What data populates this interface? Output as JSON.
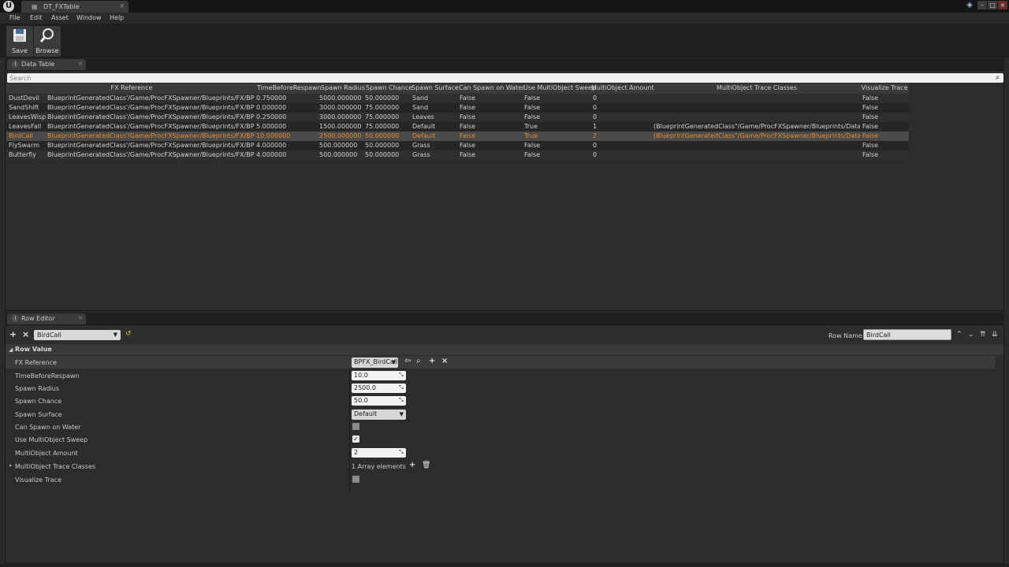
{
  "titlebar": {
    "tab_title": "DT_FXTable"
  },
  "menu": [
    "File",
    "Edit",
    "Asset",
    "Window",
    "Help"
  ],
  "toolbar": {
    "save_label": "Save",
    "browse_label": "Browse"
  },
  "data_table": {
    "tab_label": "Data Table",
    "search_placeholder": "Search",
    "columns": [
      "FX Reference",
      "TimeBeforeRespawn",
      "Spawn Radius",
      "Spawn Chance",
      "Spawn Surface",
      "Can Spawn on Water",
      "Use MultiObject Sweep",
      "MultiObject Amount",
      "MultiObject Trace Classes",
      "Visualize Trace"
    ],
    "rows": [
      {
        "name": "DustDevil",
        "fx": "BlueprintGeneratedClass'/Game/ProcFXSpawner/Blueprints/FX/BPFX_D",
        "time": "0.750000",
        "radius": "5000.000000",
        "chance": "50.000000",
        "surface": "Sand",
        "water": "False",
        "sweep": "False",
        "amount": "0",
        "classes": "",
        "visualize": "False"
      },
      {
        "name": "SandShift",
        "fx": "BlueprintGeneratedClass'/Game/ProcFXSpawner/Blueprints/FX/BPFX_S",
        "time": "0.000000",
        "radius": "3000.000000",
        "chance": "75.000000",
        "surface": "Sand",
        "water": "False",
        "sweep": "False",
        "amount": "0",
        "classes": "",
        "visualize": "False"
      },
      {
        "name": "LeavesWisp",
        "fx": "BlueprintGeneratedClass'/Game/ProcFXSpawner/Blueprints/FX/BPFX_L",
        "time": "0.250000",
        "radius": "3000.000000",
        "chance": "75.000000",
        "surface": "Leaves",
        "water": "False",
        "sweep": "False",
        "amount": "0",
        "classes": "",
        "visualize": "False"
      },
      {
        "name": "LeavesFall",
        "fx": "BlueprintGeneratedClass'/Game/ProcFXSpawner/Blueprints/FX/BPFX_L",
        "time": "5.000000",
        "radius": "1500.000000",
        "chance": "75.000000",
        "surface": "Default",
        "water": "False",
        "sweep": "True",
        "amount": "1",
        "classes": "(BlueprintGeneratedClass\"/Game/ProcFXSpawner/Blueprints/Data/Folia",
        "visualize": "False"
      },
      {
        "name": "BirdCall",
        "fx": "BlueprintGeneratedClass'/Game/ProcFXSpawner/Blueprints/FX/BPFX_B",
        "time": "10.000000",
        "radius": "2500.000000",
        "chance": "50.000000",
        "surface": "Default",
        "water": "False",
        "sweep": "True",
        "amount": "2",
        "classes": "(BlueprintGeneratedClass\"/Game/ProcFXSpawner/Blueprints/Data/Folia",
        "visualize": "False",
        "selected": true
      },
      {
        "name": "FlySwarm",
        "fx": "BlueprintGeneratedClass'/Game/ProcFXSpawner/Blueprints/FX/BPFX_F",
        "time": "4.000000",
        "radius": "500.000000",
        "chance": "50.000000",
        "surface": "Grass",
        "water": "False",
        "sweep": "False",
        "amount": "0",
        "classes": "",
        "visualize": "False"
      },
      {
        "name": "Butterfly",
        "fx": "BlueprintGeneratedClass'/Game/ProcFXSpawner/Blueprints/FX/BPFX_B",
        "time": "4.000000",
        "radius": "500.000000",
        "chance": "50.000000",
        "surface": "Grass",
        "water": "False",
        "sweep": "False",
        "amount": "0",
        "classes": "",
        "visualize": "False"
      }
    ]
  },
  "row_editor": {
    "tab_label": "Row Editor",
    "selected_row": "BirdCall",
    "row_name_label": "Row Name:",
    "row_name_value": "BirdCall",
    "section_title": "Row Value",
    "props": {
      "fx_reference": {
        "label": "FX Reference",
        "value": "BPFX_BirdCall"
      },
      "time_before_respawn": {
        "label": "TimeBeforeRespawn",
        "value": "10.0"
      },
      "spawn_radius": {
        "label": "Spawn Radius",
        "value": "2500.0"
      },
      "spawn_chance": {
        "label": "Spawn Chance",
        "value": "50.0"
      },
      "spawn_surface": {
        "label": "Spawn Surface",
        "value": "Default"
      },
      "can_spawn_on_water": {
        "label": "Can Spawn on Water",
        "checked": false
      },
      "use_multiobject_sweep": {
        "label": "Use MultiObject Sweep",
        "checked": true
      },
      "multiobject_amount": {
        "label": "MultiObject Amount",
        "value": "2"
      },
      "multiobject_trace_classes": {
        "label": "MultiObject Trace Classes",
        "value": "1 Array elements"
      },
      "visualize_trace": {
        "label": "Visualize Trace",
        "checked": false
      }
    }
  }
}
